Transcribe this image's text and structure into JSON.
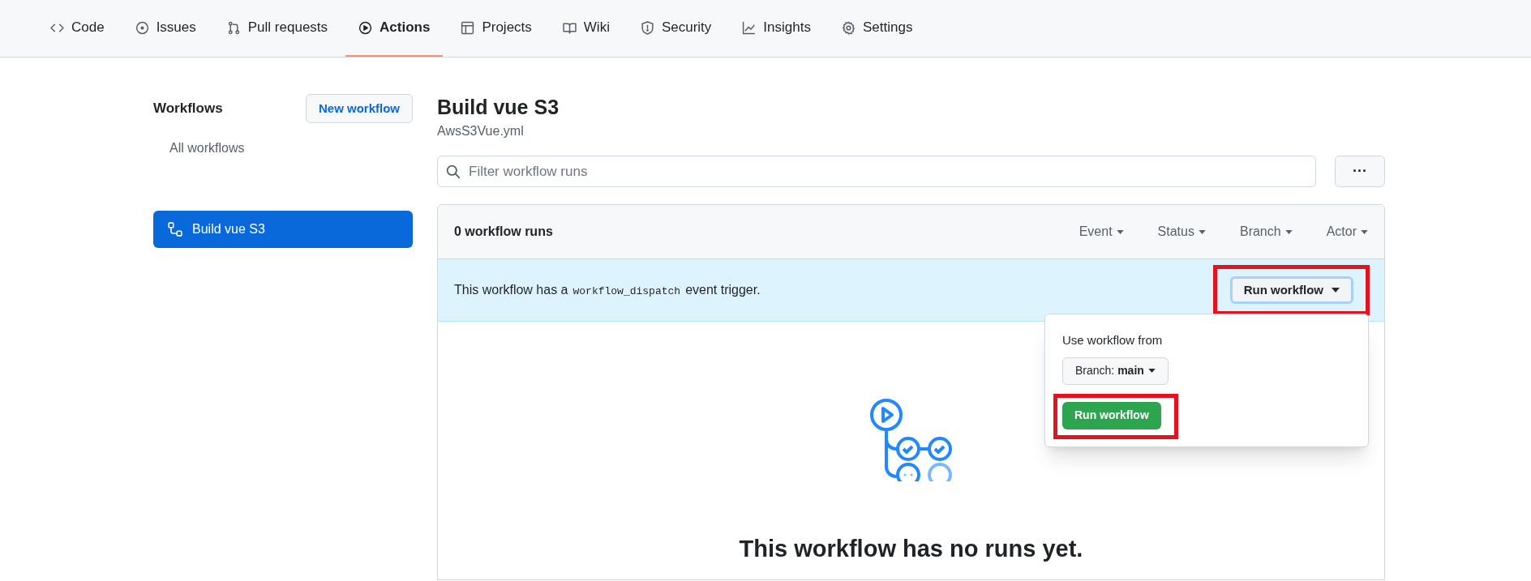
{
  "nav_tabs": [
    {
      "label": "Code",
      "selected": false
    },
    {
      "label": "Issues",
      "selected": false
    },
    {
      "label": "Pull requests",
      "selected": false
    },
    {
      "label": "Actions",
      "selected": true
    },
    {
      "label": "Projects",
      "selected": false
    },
    {
      "label": "Wiki",
      "selected": false
    },
    {
      "label": "Security",
      "selected": false
    },
    {
      "label": "Insights",
      "selected": false
    },
    {
      "label": "Settings",
      "selected": false
    }
  ],
  "sidebar": {
    "title": "Workflows",
    "new_button": "New workflow",
    "items": [
      {
        "label": "All workflows",
        "kind": "all",
        "selected": false
      },
      {
        "label": "Build vue S3",
        "kind": "workflow",
        "selected": true
      }
    ]
  },
  "workflow": {
    "title": "Build vue S3",
    "file": "AwsS3Vue.yml"
  },
  "search": {
    "placeholder": "Filter workflow runs"
  },
  "more_button": "···",
  "runs": {
    "count": "0 workflow runs",
    "filters": [
      "Event",
      "Status",
      "Branch",
      "Actor"
    ]
  },
  "banner": {
    "text_before": "This workflow has a",
    "code": "workflow_dispatch",
    "text_after": "event trigger.",
    "button": "Run workflow",
    "highlighted": true
  },
  "dropdown": {
    "label": "Use workflow from",
    "branch_prefix": "Branch:",
    "branch": "main",
    "button": "Run workflow",
    "highlighted": true
  },
  "empty": {
    "text": "This workflow has no runs yet."
  }
}
